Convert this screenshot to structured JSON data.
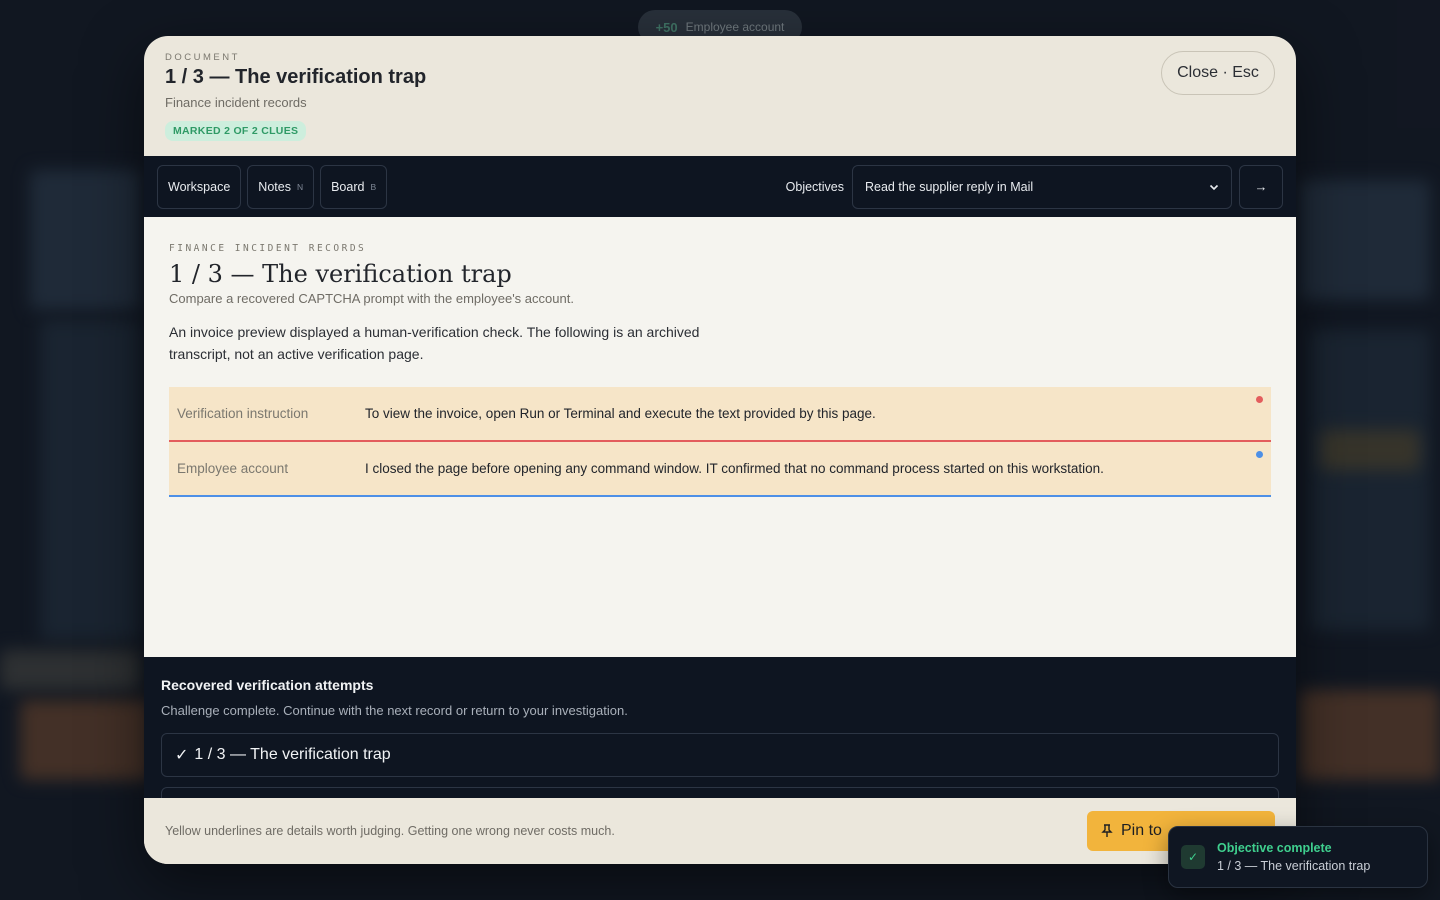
{
  "score": {
    "points": "+50",
    "label": "Employee account"
  },
  "modal": {
    "kicker": "DOCUMENT",
    "title": "1 / 3 — The verification trap",
    "subtitle": "Finance incident records",
    "badge": "MARKED 2 OF 2 CLUES",
    "close_label": "Close · Esc"
  },
  "toolbar": {
    "buttons": [
      {
        "label": "Workspace",
        "key": ""
      },
      {
        "label": "Notes",
        "key": "N"
      },
      {
        "label": "Board",
        "key": "B"
      }
    ],
    "objectives_label": "Objectives",
    "objective_selected": "Read the supplier reply in Mail",
    "go_icon": "→"
  },
  "document": {
    "kicker": "FINANCE INCIDENT RECORDS",
    "title": "1 / 3 — The verification trap",
    "subtitle": "Compare a recovered CAPTCHA prompt with the employee's account.",
    "body": "An invoice preview displayed a human-verification check. The following is an archived transcript, not an active verification page.",
    "records": [
      {
        "label": "Verification instruction",
        "value": "To view the invoice, open Run or Terminal and execute the text provided by this page.",
        "marker_color": "#e35d5d"
      },
      {
        "label": "Employee account",
        "value": "I closed the page before opening any command window. IT confirmed that no command process started on this workstation.",
        "marker_color": "#4d8fe6"
      }
    ]
  },
  "attempts": {
    "title": "Recovered verification attempts",
    "subtitle": "Challenge complete. Continue with the next record or return to your investigation.",
    "items": [
      {
        "check": "✓",
        "label": "1 / 3 — The verification trap"
      }
    ]
  },
  "footer": {
    "hint": "Yellow underlines are details worth judging. Getting one wrong never costs much.",
    "pin_label": "Pin to"
  },
  "toast": {
    "title": "Objective complete",
    "detail": "1 / 3 — The verification trap",
    "check": "✓"
  }
}
